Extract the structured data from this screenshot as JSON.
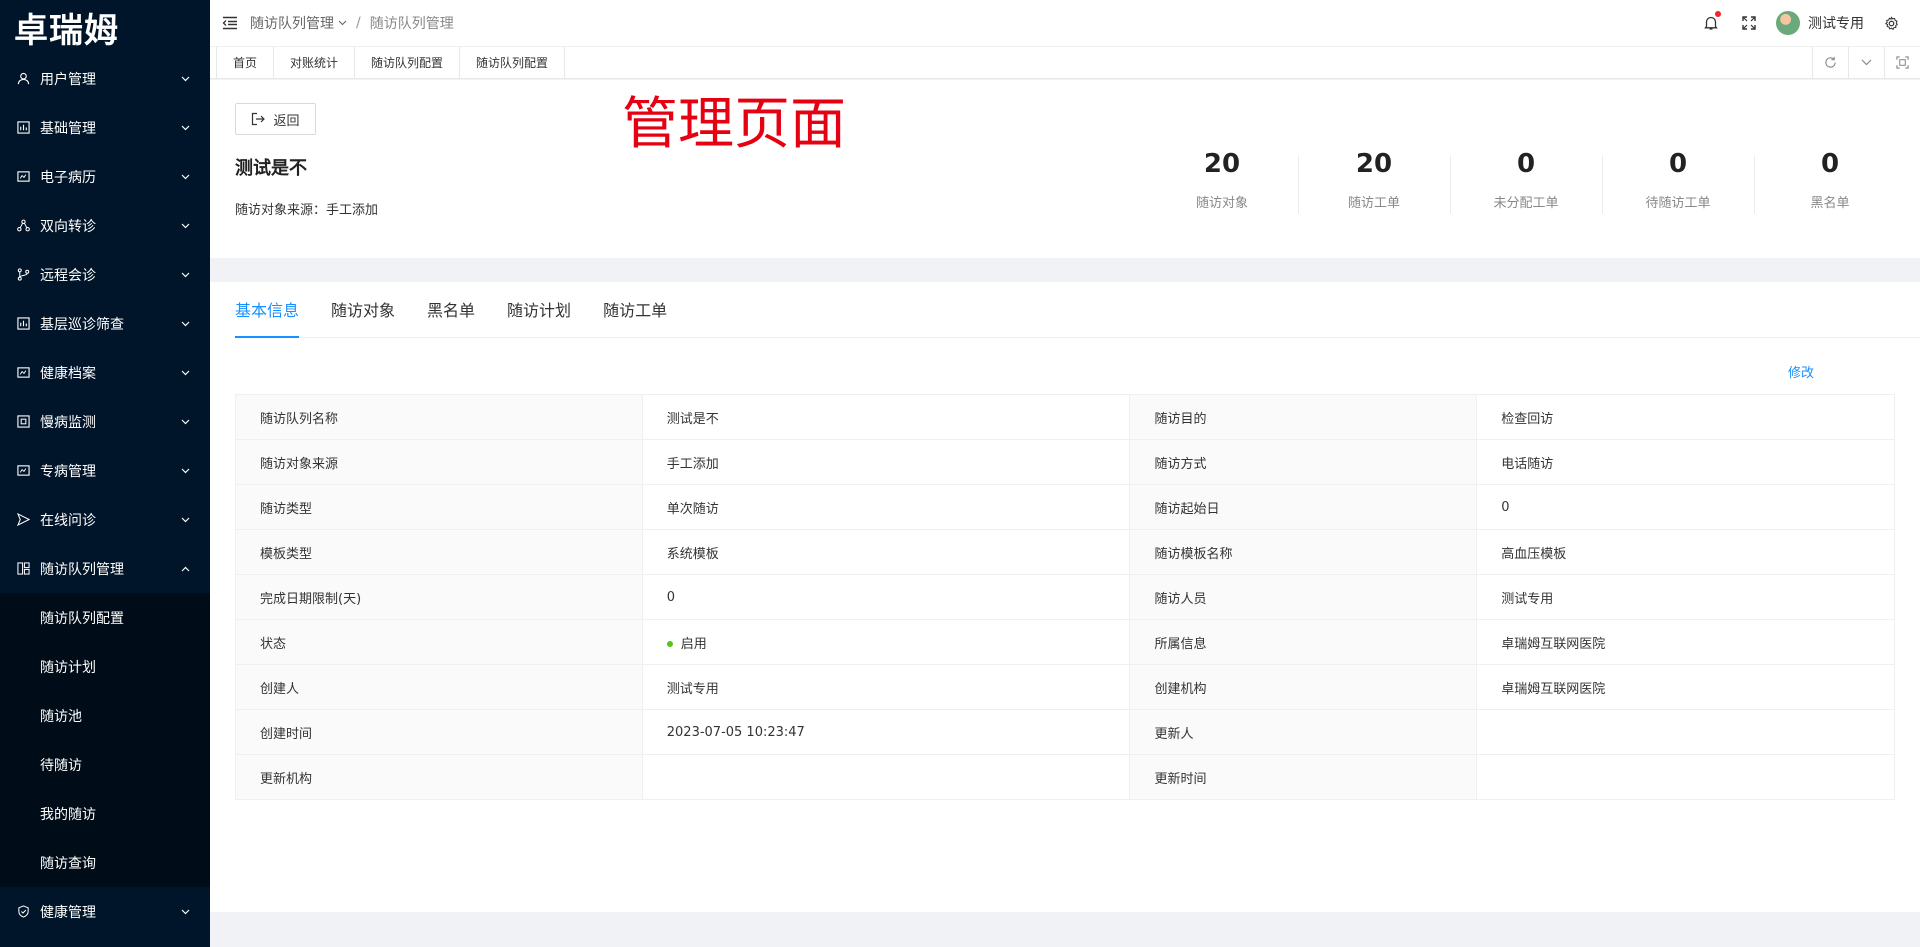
{
  "brand": {
    "logo_text": "卓瑞姆"
  },
  "sidebar": {
    "items": [
      {
        "label": "用户管理",
        "icon": "user-icon"
      },
      {
        "label": "基础管理",
        "icon": "chart-icon"
      },
      {
        "label": "电子病历",
        "icon": "record-icon"
      },
      {
        "label": "双向转诊",
        "icon": "share-icon"
      },
      {
        "label": "远程会诊",
        "icon": "branch-icon"
      },
      {
        "label": "基层巡诊筛查",
        "icon": "chart-icon"
      },
      {
        "label": "健康档案",
        "icon": "record-icon"
      },
      {
        "label": "慢病监测",
        "icon": "monitor-icon"
      },
      {
        "label": "专病管理",
        "icon": "record-icon"
      },
      {
        "label": "在线问诊",
        "icon": "send-icon"
      },
      {
        "label": "随访队列管理",
        "icon": "grid-icon"
      }
    ],
    "submenu": [
      "随访队列配置",
      "随访计划",
      "随访池",
      "待随访",
      "我的随访",
      "随访查询"
    ],
    "last_item": {
      "label": "健康管理",
      "icon": "shield-icon"
    }
  },
  "header": {
    "breadcrumb": [
      "随访队列管理",
      "随访队列管理"
    ],
    "username": "测试专用"
  },
  "tabsbar": [
    "首页",
    "对账统计",
    "随访队列配置",
    "随访队列配置"
  ],
  "page": {
    "back_label": "返回",
    "annotation": "管理页面",
    "title": "测试是不",
    "source_label": "随访对象来源：手工添加"
  },
  "stats": [
    {
      "value": "20",
      "label": "随访对象"
    },
    {
      "value": "20",
      "label": "随访工单"
    },
    {
      "value": "0",
      "label": "未分配工单"
    },
    {
      "value": "0",
      "label": "待随访工单"
    },
    {
      "value": "0",
      "label": "黑名单"
    }
  ],
  "tabs": [
    "基本信息",
    "随访对象",
    "黑名单",
    "随访计划",
    "随访工单"
  ],
  "edit_label": "修改",
  "details": [
    {
      "l1": "随访队列名称",
      "v1": "测试是不",
      "l2": "随访目的",
      "v2": "检查回访"
    },
    {
      "l1": "随访对象来源",
      "v1": "手工添加",
      "l2": "随访方式",
      "v2": "电话随访"
    },
    {
      "l1": "随访类型",
      "v1": "单次随访",
      "l2": "随访起始日",
      "v2": "0"
    },
    {
      "l1": "模板类型",
      "v1": "系统模板",
      "l2": "随访模板名称",
      "v2": "高血压模板"
    },
    {
      "l1": "完成日期限制(天)",
      "v1": "0",
      "l2": "随访人员",
      "v2": "测试专用"
    },
    {
      "l1": "状态",
      "v1": "启用",
      "l2": "所属信息",
      "v2": "卓瑞姆互联网医院"
    },
    {
      "l1": "创建人",
      "v1": "测试专用",
      "l2": "创建机构",
      "v2": "卓瑞姆互联网医院"
    },
    {
      "l1": "创建时间",
      "v1": "2023-07-05 10:23:47",
      "l2": "更新人",
      "v2": ""
    },
    {
      "l1": "更新机构",
      "v1": "",
      "l2": "更新时间",
      "v2": ""
    }
  ],
  "colors": {
    "sidebar_bg": "#001529",
    "submenu_bg": "#000c17",
    "accent": "#1890ff",
    "annotation": "#e50012",
    "status_green": "#52c41a"
  }
}
